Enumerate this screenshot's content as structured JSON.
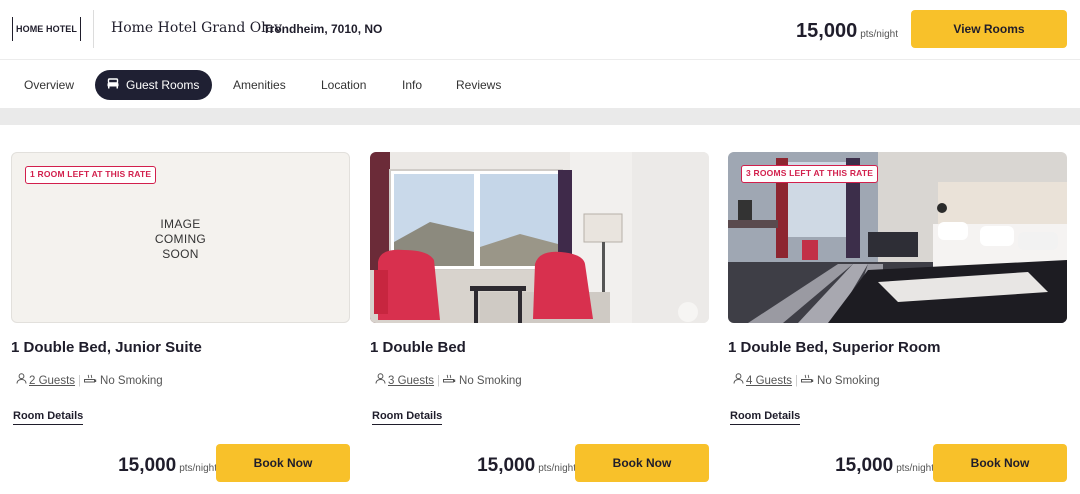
{
  "header": {
    "logo_text": "HOME HOTEL",
    "hotel_name": "Home Hotel Grand Olav",
    "location": "Trondheim, 7010, NO",
    "price": "15,000",
    "price_unit": "pts/night",
    "view_rooms_label": "View Rooms"
  },
  "tabs": [
    {
      "label": "Overview",
      "active": false
    },
    {
      "label": "Guest Rooms",
      "active": true,
      "icon": "bed-icon"
    },
    {
      "label": "Amenities",
      "active": false
    },
    {
      "label": "Location",
      "active": false
    },
    {
      "label": "Info",
      "active": false
    },
    {
      "label": "Reviews",
      "active": false
    }
  ],
  "rooms": [
    {
      "badge": "1 ROOM LEFT AT THIS RATE",
      "image_placeholder": "IMAGE\nCOMING\nSOON",
      "title": "1 Double Bed, Junior Suite",
      "guests": "2 Guests",
      "smoking": "No Smoking",
      "details_label": "Room Details",
      "price": "15,000",
      "price_unit": "pts/night",
      "book_label": "Book Now"
    },
    {
      "title": "1 Double Bed",
      "guests": "3 Guests",
      "smoking": "No Smoking",
      "details_label": "Room Details",
      "price": "15,000",
      "price_unit": "pts/night",
      "book_label": "Book Now"
    },
    {
      "badge": "3 ROOMS LEFT AT THIS RATE",
      "title": "1 Double Bed, Superior Room",
      "guests": "4 Guests",
      "smoking": "No Smoking",
      "details_label": "Room Details",
      "price": "15,000",
      "price_unit": "pts/night",
      "book_label": "Book Now"
    }
  ],
  "colors": {
    "accent_yellow": "#f8c12a",
    "badge_red": "#d21f4c",
    "active_tab": "#1f2033",
    "text_dark": "#1f1d2b"
  }
}
